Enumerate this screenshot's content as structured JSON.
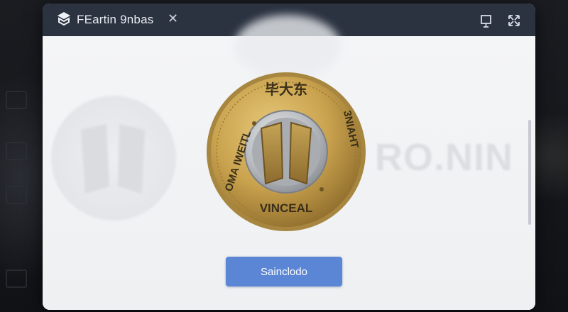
{
  "window": {
    "title": "FEartin 9nbas",
    "tab_close_icon": "close-icon",
    "controls": [
      "pin-icon",
      "expand-icon"
    ]
  },
  "coin": {
    "top_text": "毕大东",
    "left_text": "OMA IWEITL",
    "right_text": "3NIAHT",
    "bottom_text": "VINCEAL"
  },
  "background": {
    "ghost_text": "RO.NIN"
  },
  "action": {
    "button_label": "Sainсlodo"
  },
  "colors": {
    "titlebar": "#2b3240",
    "button": "#5b86d6",
    "coin_gold": "#c9a24e",
    "coin_silver": "#b9bcc0"
  }
}
